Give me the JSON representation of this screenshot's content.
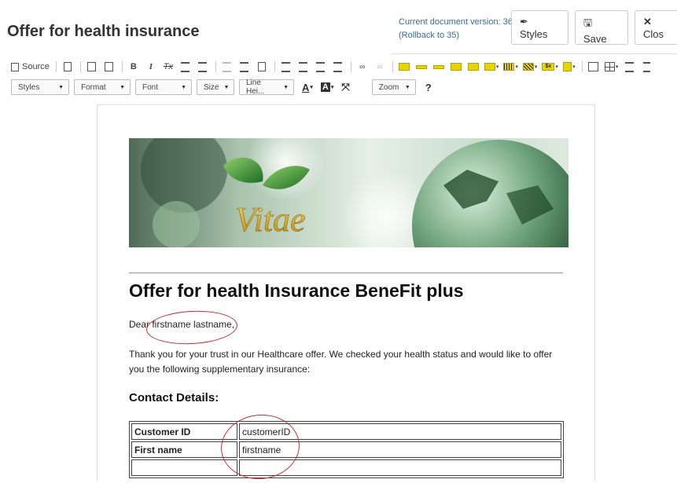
{
  "header": {
    "title": "Offer for health insurance",
    "version_text": "Current document version: 36",
    "rollback_text": "(Rollback to 35)",
    "buttons": {
      "styles": "Styles",
      "save": "Save",
      "close": "Clos"
    }
  },
  "toolbar": {
    "source_label": "Source",
    "bold": "B",
    "italic": "I",
    "clear_format": "Tx",
    "dropdowns": {
      "styles": "Styles",
      "format": "Format",
      "font": "Font",
      "size": "Size",
      "line_height": "Line Hei...",
      "zoom": "Zoom"
    },
    "help": "?"
  },
  "document": {
    "banner_logo_text": "Vitae",
    "heading": "Offer for health Insurance BeneFit plus",
    "greeting": "Dear firstname lastname,",
    "intro": "Thank you for your trust in our Healthcare offer. We checked your health status and would like to offer you the following supplementary insurance:",
    "section_title": "Contact Details:",
    "rows": [
      {
        "label": "Customer ID",
        "value": "customerID"
      },
      {
        "label": "First name",
        "value": "firstname"
      }
    ]
  },
  "colors": {
    "link_blue": "#3a6a9a",
    "annotation_red": "#d42a2a",
    "banner_green": "#5fa45a"
  }
}
